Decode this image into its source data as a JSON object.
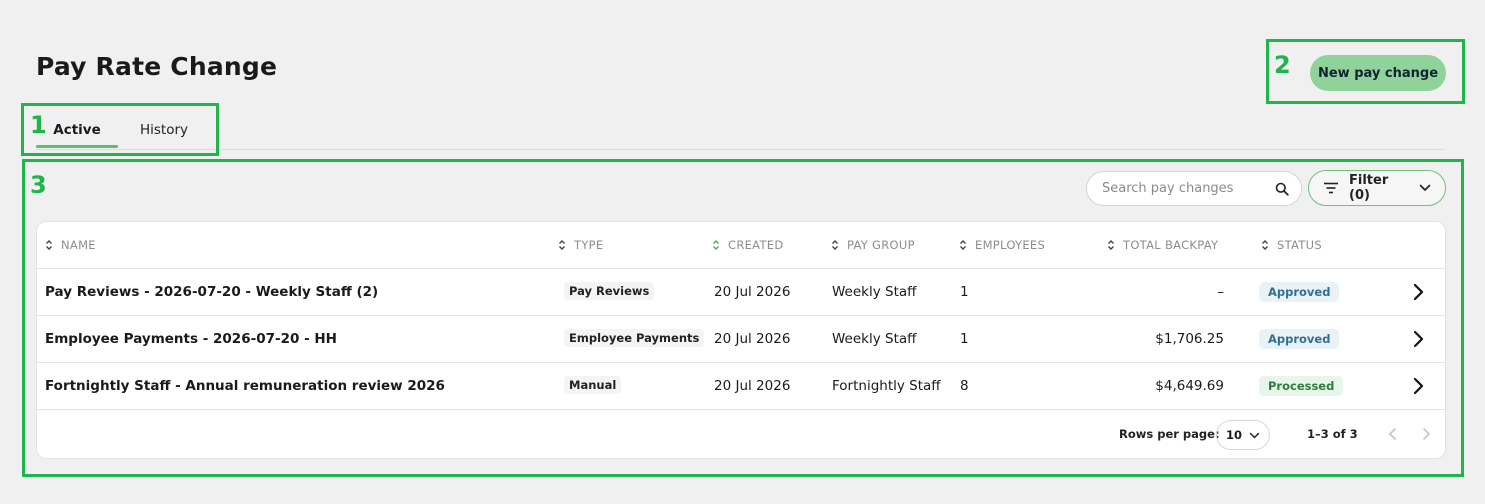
{
  "page": {
    "title": "Pay Rate Change"
  },
  "annotations": [
    "1",
    "2",
    "3"
  ],
  "tabs": [
    {
      "label": "Active",
      "active": true
    },
    {
      "label": "History",
      "active": false
    }
  ],
  "toolbar": {
    "new_button_label": "New pay change",
    "search_placeholder": "Search pay changes",
    "filter_label": "Filter (0)"
  },
  "table": {
    "columns": [
      "NAME",
      "TYPE",
      "CREATED",
      "PAY GROUP",
      "EMPLOYEES",
      "TOTAL BACKPAY",
      "STATUS"
    ],
    "sorted_column": "CREATED",
    "rows": [
      {
        "name": "Pay Reviews - 2026-07-20 - Weekly Staff (2)",
        "type": "Pay Reviews",
        "created": "20 Jul 2026",
        "pay_group": "Weekly Staff",
        "employees": "1",
        "backpay": "–",
        "status": "Approved"
      },
      {
        "name": "Employee Payments - 2026-07-20 - HH",
        "type": "Employee Payments",
        "created": "20 Jul 2026",
        "pay_group": "Weekly Staff",
        "employees": "1",
        "backpay": "$1,706.25",
        "status": "Approved"
      },
      {
        "name": "Fortnightly Staff - Annual remuneration review 2026",
        "type": "Manual",
        "created": "20 Jul 2026",
        "pay_group": "Fortnightly Staff",
        "employees": "8",
        "backpay": "$4,649.69",
        "status": "Processed"
      }
    ]
  },
  "pagination": {
    "rows_per_page_label": "Rows per page:",
    "rows_per_page": "10",
    "range": "1–3 of 3"
  },
  "colors": {
    "annotation": "#1fb54a",
    "primary_button": "#8fd39a",
    "tab_underline": "#5cbf72",
    "approved_text": "#2f6f92",
    "processed_text": "#2e7d3d"
  }
}
